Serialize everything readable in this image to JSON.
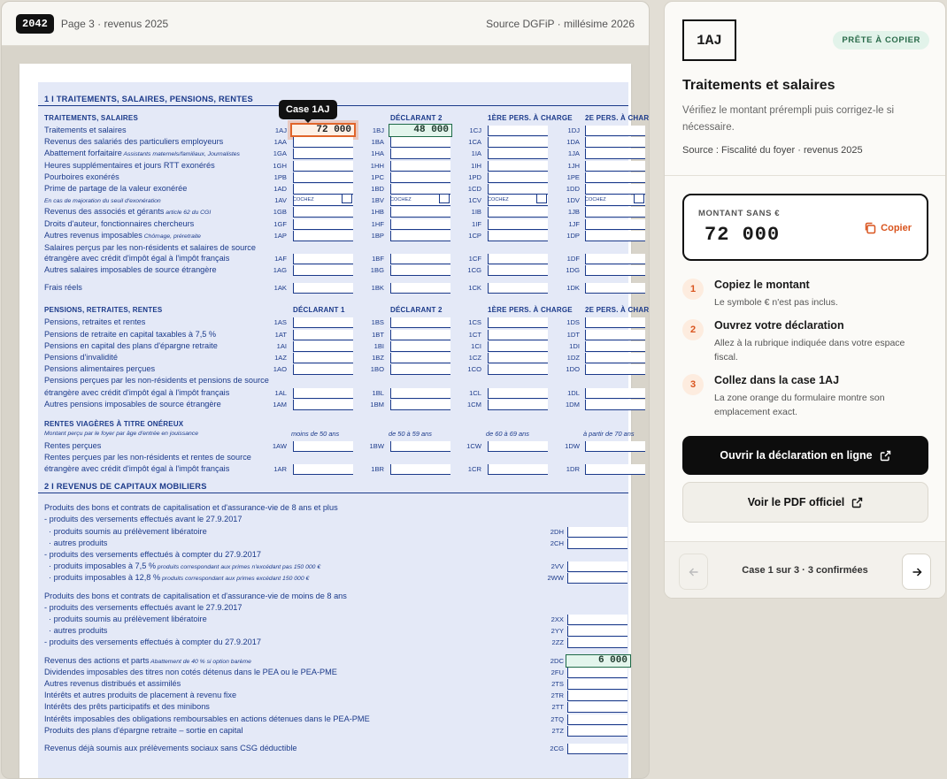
{
  "header": {
    "badge": "2042",
    "page": "Page 3 · revenus 2025",
    "source": "Source DGFiP · millésime 2026"
  },
  "tooltip": "Case 1AJ",
  "form": {
    "section1_title": "1 I TRAITEMENTS, SALAIRES, PENSIONS, RENTES",
    "col_headers_1": [
      "TRAITEMENTS, SALAIRES",
      "DÉCLARANT 2",
      "1ère PERS. À CHARGE",
      "2e PERS. À CHARGE"
    ],
    "rows_1": [
      {
        "label": "Traitements et salaires",
        "codes": [
          "1AJ",
          "1BJ",
          "1CJ",
          "1DJ"
        ],
        "y": 0
      },
      {
        "label": "Revenus des salariés des particuliers employeurs",
        "codes": [
          "1AA",
          "1BA",
          "1CA",
          "1DA"
        ]
      },
      {
        "label": "Abattement forfaitaire",
        "sub": "Assistants maternels/familiaux, Journalistes",
        "codes": [
          "1GA",
          "1HA",
          "1IA",
          "1JA"
        ]
      },
      {
        "label": "Heures supplémentaires et jours RTT exonérés",
        "codes": [
          "1GH",
          "1HH",
          "1IH",
          "1JH"
        ]
      },
      {
        "label": "Pourboires exonérés",
        "codes": [
          "1PB",
          "1PC",
          "1PD",
          "1PE"
        ]
      },
      {
        "label": "Prime de partage de la valeur exonérée",
        "codes": [
          "1AD",
          "1BD",
          "1CD",
          "1DD"
        ]
      },
      {
        "label": "",
        "sub": "En cas de majoration du seuil d'exonération",
        "codes": [
          "1AV",
          "1BV",
          "1CV",
          "1DV"
        ],
        "check": "COCHEZ"
      },
      {
        "label": "Revenus des associés et gérants",
        "sub": "article 62 du CGI",
        "codes": [
          "1GB",
          "1HB",
          "1IB",
          "1JB"
        ]
      },
      {
        "label": "Droits d'auteur, fonctionnaires chercheurs",
        "codes": [
          "1GF",
          "1HF",
          "1IF",
          "1JF"
        ]
      },
      {
        "label": "Autres revenus imposables",
        "sub": "Chômage, préretraite",
        "codes": [
          "1AP",
          "1BP",
          "1CP",
          "1DP"
        ]
      }
    ],
    "row_nr1_a": "Salaires perçus par les non-résidents et salaires de source",
    "row_nr1_b": "étrangère avec crédit d'impôt égal à l'impôt français",
    "codes_nr1": [
      "1AF",
      "1BF",
      "1CF",
      "1DF"
    ],
    "row_other_foreign": "Autres salaires imposables de source étrangère",
    "codes_other_foreign": [
      "1AG",
      "1BG",
      "1CG",
      "1DG"
    ],
    "row_frais": "Frais réels",
    "codes_frais": [
      "1AK",
      "1BK",
      "1CK",
      "1DK"
    ],
    "pensions_title": "PENSIONS, RETRAITES, RENTES",
    "col_headers_2": [
      "DÉCLARANT 1",
      "DÉCLARANT 2",
      "1ère PERS. À CHARGE",
      "2e PERS. À CHARGE"
    ],
    "rows_2": [
      {
        "label": "Pensions, retraites et rentes",
        "codes": [
          "1AS",
          "1BS",
          "1CS",
          "1DS"
        ]
      },
      {
        "label": "Pensions de retraite en capital taxables à 7,5 %",
        "codes": [
          "1AT",
          "1BT",
          "1CT",
          "1DT"
        ]
      },
      {
        "label": "Pensions en capital des plans d'épargne retraite",
        "codes": [
          "1AI",
          "1BI",
          "1CI",
          "1DI"
        ]
      },
      {
        "label": "Pensions d'invalidité",
        "codes": [
          "1AZ",
          "1BZ",
          "1CZ",
          "1DZ"
        ]
      },
      {
        "label": "Pensions alimentaires perçues",
        "codes": [
          "1AO",
          "1BO",
          "1CO",
          "1DO"
        ]
      }
    ],
    "row_nr2_a": "Pensions perçues par les non-résidents et pensions de source",
    "row_nr2_b": "étrangère avec crédit d'impôt égal à l'impôt français",
    "codes_nr2": [
      "1AL",
      "1BL",
      "1CL",
      "1DL"
    ],
    "row_other_pens": "Autres pensions imposables de source étrangère",
    "codes_other_pens": [
      "1AM",
      "1BM",
      "1CM",
      "1DM"
    ],
    "rentes_title": "RENTES VIAGÈRES À TITRE ONÉREUX",
    "rentes_sub": "Montant perçu par le foyer par âge d'entrée en jouissance",
    "age_headers": [
      "moins de 50 ans",
      "de 50 à 59 ans",
      "de 60 à 69 ans",
      "à partir de 70 ans"
    ],
    "row_rentes": "Rentes perçues",
    "codes_rentes": [
      "1AW",
      "1BW",
      "1CW",
      "1DW"
    ],
    "row_rentes_nr_a": "Rentes perçues par les non-résidents et rentes de source",
    "row_rentes_nr_b": "étrangère avec crédit d'impôt égal à l'impôt français",
    "codes_rentes_nr": [
      "1AR",
      "1BR",
      "1CR",
      "1DR"
    ],
    "section2_title": "2 I REVENUS DE CAPITAUX MOBILIERS",
    "rows_3": [
      {
        "label": "Produits des bons et contrats de capitalisation et d'assurance-vie de 8 ans et plus",
        "code": ""
      },
      {
        "label": "- produits des versements effectués avant le 27.9.2017",
        "code": ""
      },
      {
        "label": "· produits soumis au prélèvement libératoire",
        "code": "2DH",
        "indent": true
      },
      {
        "label": "· autres produits",
        "code": "2CH",
        "indent": true
      },
      {
        "label": "- produits des versements effectués à compter du 27.9.2017",
        "code": ""
      },
      {
        "label": "· produits imposables à 7,5 %",
        "sub": "produits correspondant aux primes n'excédant pas 150 000 €",
        "code": "2VV",
        "indent": true
      },
      {
        "label": "· produits imposables à 12,8 %",
        "sub": "produits correspondant aux primes excédant 150 000 €",
        "code": "2WW",
        "indent": true
      }
    ],
    "rows_4": [
      {
        "label": "Produits des bons et contrats de capitalisation et d'assurance-vie de moins de 8 ans",
        "code": ""
      },
      {
        "label": "- produits des versements effectués avant le 27.9.2017",
        "code": ""
      },
      {
        "label": "· produits soumis au prélèvement libératoire",
        "code": "2XX",
        "indent": true
      },
      {
        "label": "· autres produits",
        "code": "2YY",
        "indent": true
      },
      {
        "label": "- produits des versements effectués à compter du 27.9.2017",
        "code": "2ZZ"
      }
    ],
    "rows_5": [
      {
        "label": "Revenus des actions et parts",
        "sub": "Abattement de 40 % si option barème",
        "code": "2DC"
      },
      {
        "label": "Dividendes imposables des titres non cotés détenus dans le PEA ou le PEA-PME",
        "code": "2FU"
      },
      {
        "label": "Autres revenus distribués et assimilés",
        "code": "2TS"
      },
      {
        "label": "Intérêts et autres produits de placement à revenu fixe",
        "code": "2TR"
      },
      {
        "label": "Intérêts des prêts participatifs et des minibons",
        "code": "2TT"
      },
      {
        "label": "Intérêts imposables des obligations remboursables en actions détenues dans le PEA-PME",
        "code": "2TQ"
      },
      {
        "label": "Produits des plans d'épargne retraite – sortie en capital",
        "code": "2TZ"
      }
    ],
    "row_last": "Revenus déjà soumis aux prélèvements sociaux sans CSG déductible",
    "code_last": "2CG",
    "values": {
      "1AJ": "72 000",
      "1BJ": "48 000",
      "2DC": "6 000"
    }
  },
  "panel": {
    "case_badge": "1AJ",
    "status": "PRÊTE À COPIER",
    "title": "Traitements et salaires",
    "description": "Vérifiez le montant prérempli puis corrigez-le si nécessaire.",
    "source": "Source : Fiscalité du foyer · revenus 2025",
    "amount_label": "MONTANT SANS €",
    "amount_value": "72 000",
    "copy_label": "Copier",
    "steps": [
      {
        "num": "1",
        "title": "Copiez le montant",
        "desc": "Le symbole € n'est pas inclus."
      },
      {
        "num": "2",
        "title": "Ouvrez votre déclaration",
        "desc": "Allez à la rubrique indiquée dans votre espace fiscal."
      },
      {
        "num": "3",
        "title": "Collez dans la case 1AJ",
        "desc": "La zone orange du formulaire montre son emplacement exact."
      }
    ],
    "open_online": "Ouvrir la déclaration en ligne",
    "view_pdf": "Voir le PDF officiel",
    "nav_text": "Case 1 sur 3 · 3 confirmées"
  },
  "colors": {
    "accent": "#d9541e",
    "form_blue": "#1b3a8a",
    "form_bg": "#e4e9f7",
    "ready_green": "#2a6b4a"
  }
}
